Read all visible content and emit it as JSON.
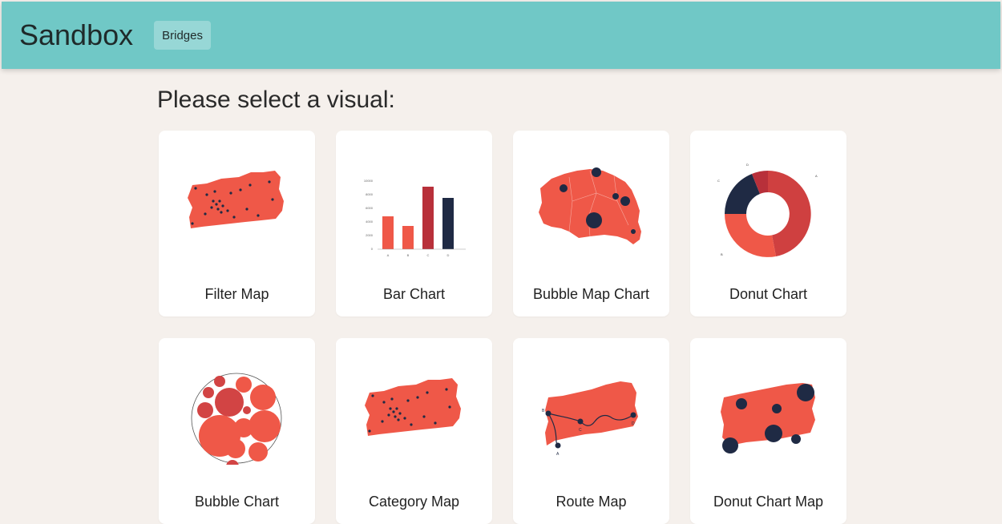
{
  "header": {
    "brand": "Sandbox",
    "nav_button": "Bridges"
  },
  "main": {
    "heading": "Please select a visual:",
    "visuals": [
      {
        "label": "Filter Map",
        "thumbnail": "filter-map-icon"
      },
      {
        "label": "Bar Chart",
        "thumbnail": "bar-chart-icon",
        "axis_ticks": [
          "10000",
          "8000",
          "6000",
          "4000",
          "2000",
          "0"
        ],
        "categories": [
          "A",
          "B",
          "C",
          "D"
        ]
      },
      {
        "label": "Bubble Map Chart",
        "thumbnail": "bubble-map-icon"
      },
      {
        "label": "Donut Chart",
        "thumbnail": "donut-chart-icon",
        "segments": [
          "A",
          "B",
          "C",
          "D"
        ]
      },
      {
        "label": "Bubble Chart",
        "thumbnail": "bubble-chart-icon"
      },
      {
        "label": "Category Map",
        "thumbnail": "category-map-icon"
      },
      {
        "label": "Route Map",
        "thumbnail": "route-map-icon",
        "points": [
          "B",
          "C",
          "D",
          "A"
        ]
      },
      {
        "label": "Donut Chart Map",
        "thumbnail": "donut-chart-map-icon"
      }
    ]
  },
  "colors": {
    "header_bg": "#70c8c6",
    "page_bg": "#f5f0ec",
    "map_red": "#ef5848",
    "dark_navy": "#1f2a44",
    "dark_red": "#b8303a"
  }
}
